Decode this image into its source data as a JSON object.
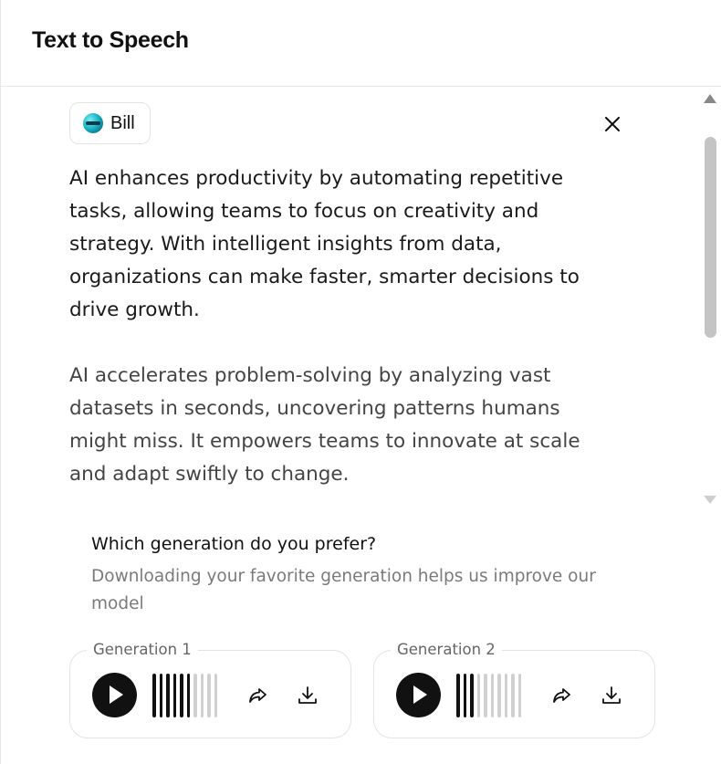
{
  "header": {
    "title": "Text to Speech"
  },
  "voice": {
    "name": "Bill"
  },
  "content": {
    "paragraph_1": "AI enhances productivity by automating repetitive tasks, allowing teams to focus on creativity and strategy. With intelligent insights from data, organizations can make faster, smarter decisions to drive growth.",
    "paragraph_2": "AI accelerates problem-solving by analyzing vast datasets in seconds, uncovering patterns humans might miss. It empowers teams to innovate at scale and adapt swiftly to change."
  },
  "preference": {
    "title": "Which generation do you prefer?",
    "subtitle": "Downloading your favorite generation helps us improve our model"
  },
  "generations": [
    {
      "label": "Generation 1",
      "progress_fraction": 0.6
    },
    {
      "label": "Generation 2",
      "progress_fraction": 0.3
    }
  ],
  "icons": {
    "close": "close-icon",
    "play": "play-icon",
    "share": "share-icon",
    "download": "download-icon"
  },
  "colors": {
    "accent": "#111111",
    "waveform_inactive": "#d0d0d0",
    "secondary_text": "#7a7a7a"
  }
}
